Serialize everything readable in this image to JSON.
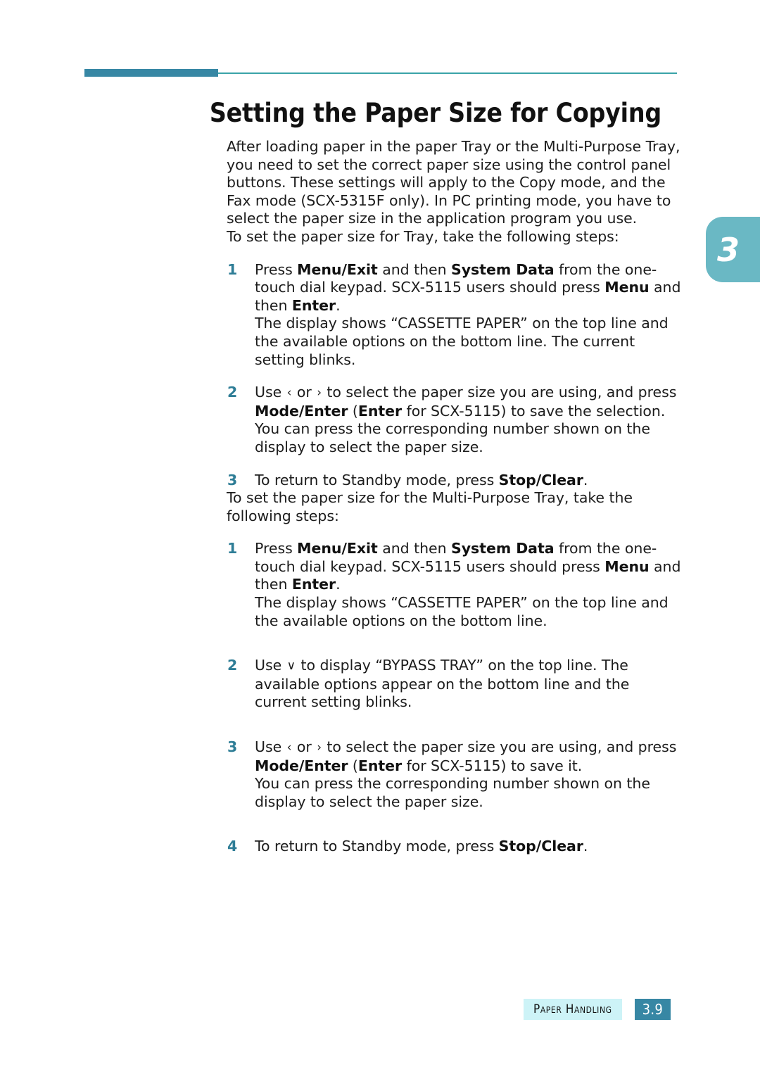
{
  "chapter_tab": {
    "number": "3"
  },
  "title": "Setting the Paper Size for Copying",
  "intro": {
    "paragraph": "After loading paper in the paper Tray or the Multi-Purpose Tray, you need to set the correct paper size using the control panel buttons. These settings will apply to the Copy mode, and the Fax mode (SCX-5315F only). In PC printing mode, you have to select the paper size in the application program you use."
  },
  "section_tray": {
    "lead": "To set the paper size for Tray, take the following steps:",
    "steps": [
      {
        "number": "1",
        "text_parts": [
          {
            "t": "Press ",
            "b": false
          },
          {
            "t": "Menu/Exit",
            "b": true
          },
          {
            "t": " and then ",
            "b": false
          },
          {
            "t": "System Data",
            "b": true
          },
          {
            "t": " from the one-touch dial keypad. SCX-5115 users should press ",
            "b": false
          },
          {
            "t": "Menu",
            "b": true
          },
          {
            "t": " and then ",
            "b": false
          },
          {
            "t": "Enter",
            "b": true
          },
          {
            "t": ".",
            "b": false
          }
        ],
        "note": "The display shows “CASSETTE PAPER” on the top line and the available options on the bottom line. The current setting blinks."
      },
      {
        "number": "2",
        "text_parts": [
          {
            "t": "Use ",
            "b": false
          },
          {
            "t": "‹",
            "b": false,
            "arrow": true
          },
          {
            "t": " or ",
            "b": false
          },
          {
            "t": "›",
            "b": false,
            "arrow": true
          },
          {
            "t": " to select the paper size you are using, and press ",
            "b": false
          },
          {
            "t": "Mode/Enter",
            "b": true
          },
          {
            "t": " (",
            "b": false
          },
          {
            "t": "Enter",
            "b": true
          },
          {
            "t": " for SCX-5115) to save the selection.",
            "b": false
          }
        ],
        "note": "You can press the corresponding number shown on the display to select the paper size."
      },
      {
        "number": "3",
        "text_parts": [
          {
            "t": "To return to Standby mode, press ",
            "b": false
          },
          {
            "t": "Stop/Clear",
            "b": true
          },
          {
            "t": ".",
            "b": false
          }
        ],
        "note": ""
      }
    ]
  },
  "section_mp_tray": {
    "lead": "To set the paper size for the Multi-Purpose Tray, take the following steps:",
    "steps": [
      {
        "number": "1",
        "text_parts": [
          {
            "t": "Press ",
            "b": false
          },
          {
            "t": "Menu/Exit",
            "b": true
          },
          {
            "t": " and then ",
            "b": false
          },
          {
            "t": "System Data",
            "b": true
          },
          {
            "t": " from the one-touch dial keypad. SCX-5115 users should press ",
            "b": false
          },
          {
            "t": "Menu",
            "b": true
          },
          {
            "t": " and then ",
            "b": false
          },
          {
            "t": "Enter",
            "b": true
          },
          {
            "t": ".",
            "b": false
          }
        ],
        "note": "The display shows “CASSETTE PAPER” on the top line and the available options on the bottom line."
      },
      {
        "number": "2",
        "text_parts": [
          {
            "t": "Use ",
            "b": false
          },
          {
            "t": "∨",
            "b": false,
            "arrow": true
          },
          {
            "t": " to display “BYPASS TRAY” on the top line. The available options appear on the bottom line and the current setting blinks.",
            "b": false
          }
        ],
        "note": ""
      },
      {
        "number": "3",
        "text_parts": [
          {
            "t": "Use ",
            "b": false
          },
          {
            "t": "‹",
            "b": false,
            "arrow": true
          },
          {
            "t": " or ",
            "b": false
          },
          {
            "t": "›",
            "b": false,
            "arrow": true
          },
          {
            "t": " to select the paper size you are using, and press ",
            "b": false
          },
          {
            "t": "Mode/Enter",
            "b": true
          },
          {
            "t": " (",
            "b": false
          },
          {
            "t": "Enter",
            "b": true
          },
          {
            "t": " for SCX-5115) to save it.",
            "b": false
          }
        ],
        "note": "You can press the corresponding number shown on the display to select the paper size."
      },
      {
        "number": "4",
        "text_parts": [
          {
            "t": "To return to Standby mode, press ",
            "b": false
          },
          {
            "t": "Stop/Clear",
            "b": true
          },
          {
            "t": ".",
            "b": false
          }
        ],
        "note": ""
      }
    ]
  },
  "footer": {
    "label": "Paper Handling",
    "page": "3.9"
  },
  "colors": {
    "accent_teal": "#3787a4",
    "tab_teal": "#6ab8c4",
    "rule_thin": "#3aa3a8",
    "step_number": "#2e7d96",
    "footer_label_bg": "#cdf3f7"
  }
}
